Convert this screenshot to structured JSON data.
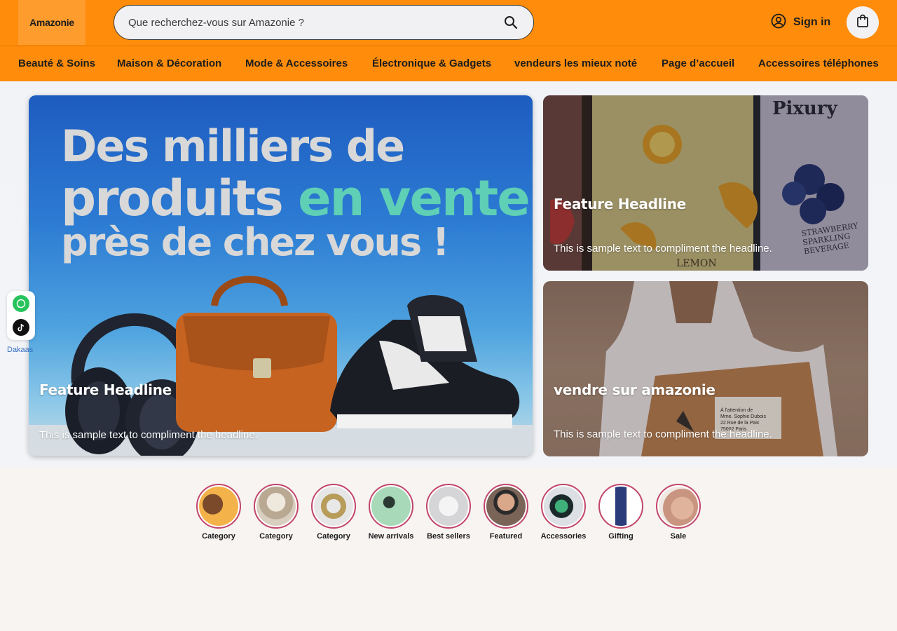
{
  "header": {
    "logo": "Amazonie",
    "search_placeholder": "Que recherchez-vous sur Amazonie ?",
    "sign_in_label": "Sign in",
    "icons": {
      "search": "search-icon",
      "account": "user-circle-icon",
      "cart": "shopping-bag-icon"
    }
  },
  "nav": {
    "items": [
      "Beauté & Soins",
      "Maison & Décoration",
      "Mode & Accessoires",
      "Électronique & Gadgets",
      "vendeurs les mieux noté",
      "Page d’accueil",
      "Accessoires téléphones"
    ]
  },
  "hero": {
    "main": {
      "banner_line1": "Des milliers de",
      "banner_line2a": "produits ",
      "banner_line2b": "en vente",
      "banner_line3": "près de chez vous !",
      "headline": "Feature Headline",
      "text": "This is sample text to compliment the headline."
    },
    "fruit": {
      "headline": "Feature Headline",
      "text": "This is sample text to compliment the headline.",
      "brand": "Pixury",
      "label_lines": [
        "STRAWBERRY",
        "SPARKLING",
        "BEVERAGE"
      ],
      "lemon_label": "LEMON"
    },
    "delivery": {
      "headline": "vendre sur amazonie",
      "text": "This is sample text to compliment the headline.",
      "parcel_lines": [
        "À l'attention de",
        "Mme. Sophie Dubois",
        "22 Rue de la Paix",
        "75002 Paris"
      ]
    }
  },
  "social": {
    "label": "Dakaas",
    "icons": [
      "whatsapp-icon",
      "tiktok-icon"
    ]
  },
  "categories": [
    {
      "label": "Category",
      "color": "#f4b24a"
    },
    {
      "label": "Category",
      "color": "#d9cfc0"
    },
    {
      "label": "Category",
      "color": "#b89c5a"
    },
    {
      "label": "New arrivals",
      "color": "#a8d9b8"
    },
    {
      "label": "Best sellers",
      "color": "#d5d5d8"
    },
    {
      "label": "Featured",
      "color": "#7a6458"
    },
    {
      "label": "Accessories",
      "color": "#3fb07a"
    },
    {
      "label": "Gifting",
      "color": "#2a3c7a"
    },
    {
      "label": "Sale",
      "color": "#c99580"
    }
  ],
  "colors": {
    "brand": "#ff8c0a",
    "accent": "#5fcfb5",
    "ring": "#c2456b"
  }
}
